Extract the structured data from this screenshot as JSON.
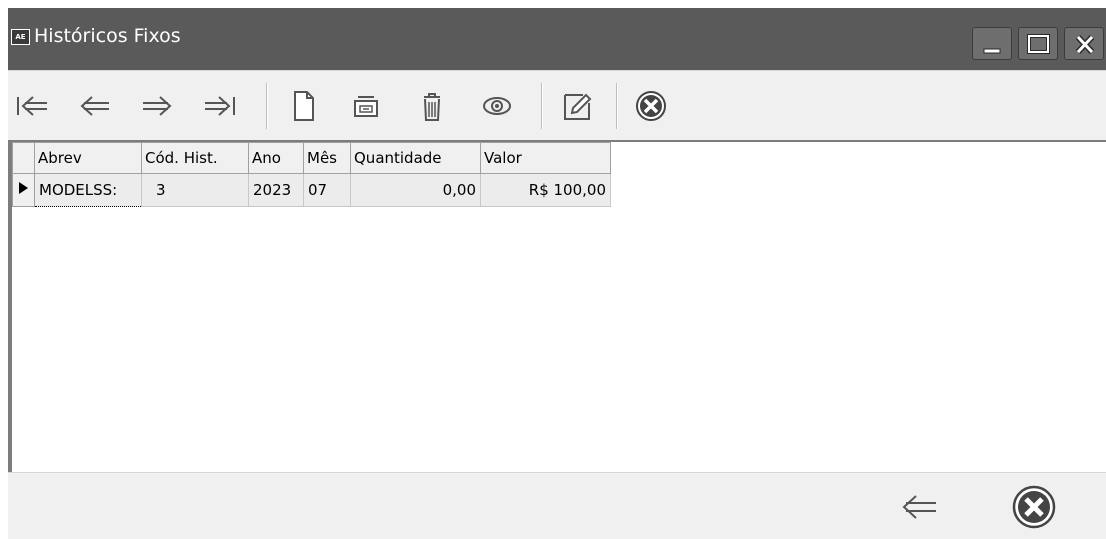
{
  "window": {
    "app_icon_text": "AE",
    "title": "Históricos Fixos"
  },
  "titlebar_buttons": [
    "minimize-icon",
    "maximize-icon",
    "close-icon"
  ],
  "toolbar": {
    "buttons": [
      {
        "name": "first-record-icon"
      },
      {
        "name": "previous-record-icon"
      },
      {
        "name": "next-record-icon"
      },
      {
        "name": "last-record-icon"
      },
      {
        "name": "new-record-icon"
      },
      {
        "name": "copy-record-icon"
      },
      {
        "name": "delete-icon"
      },
      {
        "name": "view-icon"
      },
      {
        "name": "edit-icon"
      },
      {
        "name": "cancel-icon"
      }
    ]
  },
  "grid": {
    "columns": [
      "Abrev",
      "Cód. Hist.",
      "Ano",
      "Mês",
      "Quantidade",
      "Valor"
    ],
    "rows": [
      {
        "abrev": "MODELSS:",
        "cod_hist": "3",
        "ano": "2023",
        "mes": "07",
        "quantidade": "0,00",
        "valor": "R$ 100,00"
      }
    ]
  },
  "footer": {
    "buttons": [
      {
        "name": "back-icon"
      },
      {
        "name": "close-circle-icon"
      }
    ]
  },
  "colors": {
    "titlebar": "#5a5a5a",
    "panel": "#f0f0f0",
    "grid_bg": "#ffffff",
    "cell_bg": "#ececec"
  }
}
